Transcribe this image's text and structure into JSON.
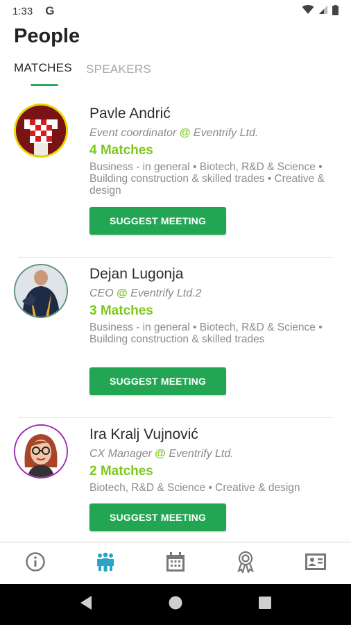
{
  "status_bar": {
    "time": "1:33",
    "g_label": "G",
    "icons": [
      "wifi-icon",
      "signal-icon",
      "battery-icon"
    ]
  },
  "page": {
    "title": "People"
  },
  "tabs": [
    {
      "label": "MATCHES",
      "active": true
    },
    {
      "label": "SPEAKERS",
      "active": false
    }
  ],
  "people": [
    {
      "name": "Pavle Andrić",
      "role": "Event coordinator",
      "at": "@",
      "company": "Eventrify Ltd.",
      "matches": "4 Matches",
      "tags": "Business - in general • Biotech, R&D & Science • Building construction & skilled trades • Creative & design",
      "button": "SUGGEST MEETING",
      "avatar_ring": "#e8d800"
    },
    {
      "name": "Dejan Lugonja",
      "role": "CEO",
      "at": "@",
      "company": "Eventrify Ltd.2",
      "matches": "3 Matches",
      "tags": "Business - in general • Biotech, R&D & Science • Building construction & skilled trades",
      "button": "SUGGEST MEETING",
      "avatar_ring": "#5e8f85"
    },
    {
      "name": "Ira Kralj Vujnović",
      "role": "CX Manager",
      "at": "@",
      "company": "Eventrify Ltd.",
      "matches": "2 Matches",
      "tags": "Biotech, R&D & Science • Creative & design",
      "button": "SUGGEST MEETING",
      "avatar_ring": "#a02bb8"
    }
  ],
  "bottom_nav": [
    {
      "icon": "info-icon",
      "active": false
    },
    {
      "icon": "people-icon",
      "active": true
    },
    {
      "icon": "calendar-icon",
      "active": false
    },
    {
      "icon": "award-icon",
      "active": false
    },
    {
      "icon": "contact-card-icon",
      "active": false
    }
  ],
  "android_nav": [
    "back-icon",
    "home-icon",
    "recents-icon"
  ],
  "colors": {
    "accent_green": "#23a654",
    "match_green": "#7cc91a",
    "active_tab_icon": "#2ba3c4",
    "inactive_icon": "#777777"
  }
}
